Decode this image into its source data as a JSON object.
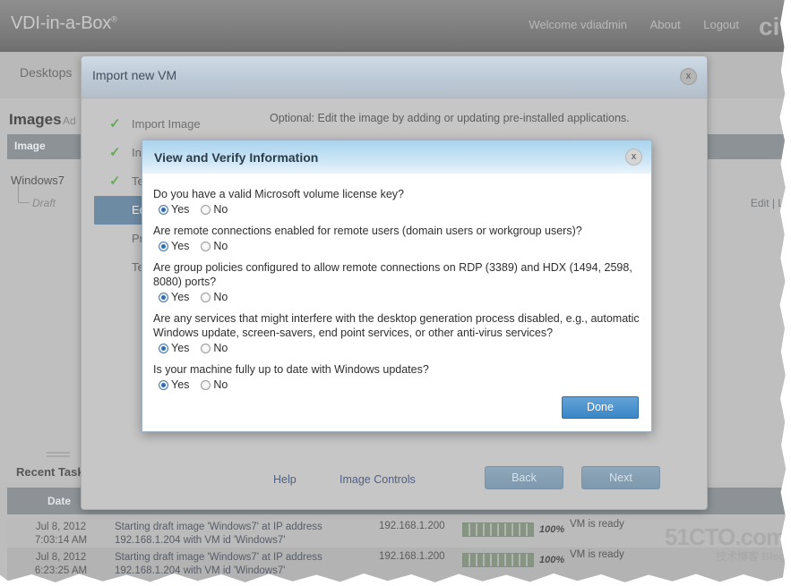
{
  "app": {
    "brand": "VDI-in-a-Box",
    "brand_trademark": "®",
    "logo_text": "ci",
    "topnav": {
      "welcome": "Welcome vdiadmin",
      "about": "About",
      "logout": "Logout"
    },
    "tabs": [
      {
        "label": "Desktops"
      }
    ],
    "page_title": "Images",
    "page_actions": "Ad",
    "images_table": {
      "header": "Image",
      "rows": [
        {
          "name": "Windows7",
          "substate": "Draft",
          "actions": "Edit | L"
        }
      ]
    },
    "recent_tasks": {
      "title": "Recent Tasks",
      "columns": [
        "Date"
      ],
      "rows": [
        {
          "date": "Jul 8, 2012",
          "time": "7:03:14 AM",
          "message": "Starting draft image 'Windows7' at IP address 192.168.1.204 with VM id 'Windows7'",
          "ip": "192.168.1.200",
          "percent": "100%",
          "status": "VM is ready"
        },
        {
          "date": "Jul 8, 2012",
          "time": "6:23:25 AM",
          "message": "Starting draft image 'Windows7' at IP address 192.168.1.204 with VM id 'Windows7'",
          "ip": "192.168.1.200",
          "percent": "100%",
          "status": "VM is ready"
        }
      ]
    },
    "watermark": {
      "main": "51CTO.com",
      "sub": "技术博客    Blog"
    }
  },
  "import_modal": {
    "title": "Import new VM",
    "close_label": "x",
    "optional_note": "Optional: Edit the image by adding or updating pre-installed applications.",
    "steps": [
      {
        "label": "Import Image",
        "done": true,
        "active": false
      },
      {
        "label": "Install",
        "done": true,
        "active": false
      },
      {
        "label": "Test",
        "done": true,
        "active": false
      },
      {
        "label": "Edit",
        "done": false,
        "active": true
      },
      {
        "label": "Prepare",
        "done": false,
        "active": false
      },
      {
        "label": "Test",
        "done": false,
        "active": false
      }
    ],
    "footer": {
      "help": "Help",
      "image_controls": "Image Controls",
      "back": "Back",
      "next": "Next"
    }
  },
  "verify_modal": {
    "title": "View and Verify Information",
    "close_label": "x",
    "yes_label": "Yes",
    "no_label": "No",
    "done_label": "Done",
    "questions": [
      {
        "text": "Do you have a valid Microsoft volume license key?",
        "answer": "Yes"
      },
      {
        "text": "Are remote connections enabled for remote users (domain users or workgroup users)?",
        "answer": "Yes"
      },
      {
        "text": "Are group policies configured to allow remote connections on RDP (3389) and HDX (1494, 2598, 8080) ports?",
        "answer": "Yes"
      },
      {
        "text": "Are any services that might interfere with the desktop generation process disabled, e.g., automatic Windows update, screen-savers, end point services, or other anti-virus services?",
        "answer": "Yes"
      },
      {
        "text": "Is your machine fully up to date with Windows updates?",
        "answer": "Yes"
      }
    ]
  },
  "colors": {
    "accent_blue": "#3a86c6",
    "header_blue": "#7d95a5",
    "step_active": "#6e8ba4",
    "check_green": "#6aa85c",
    "progress_green": "#63a354"
  }
}
